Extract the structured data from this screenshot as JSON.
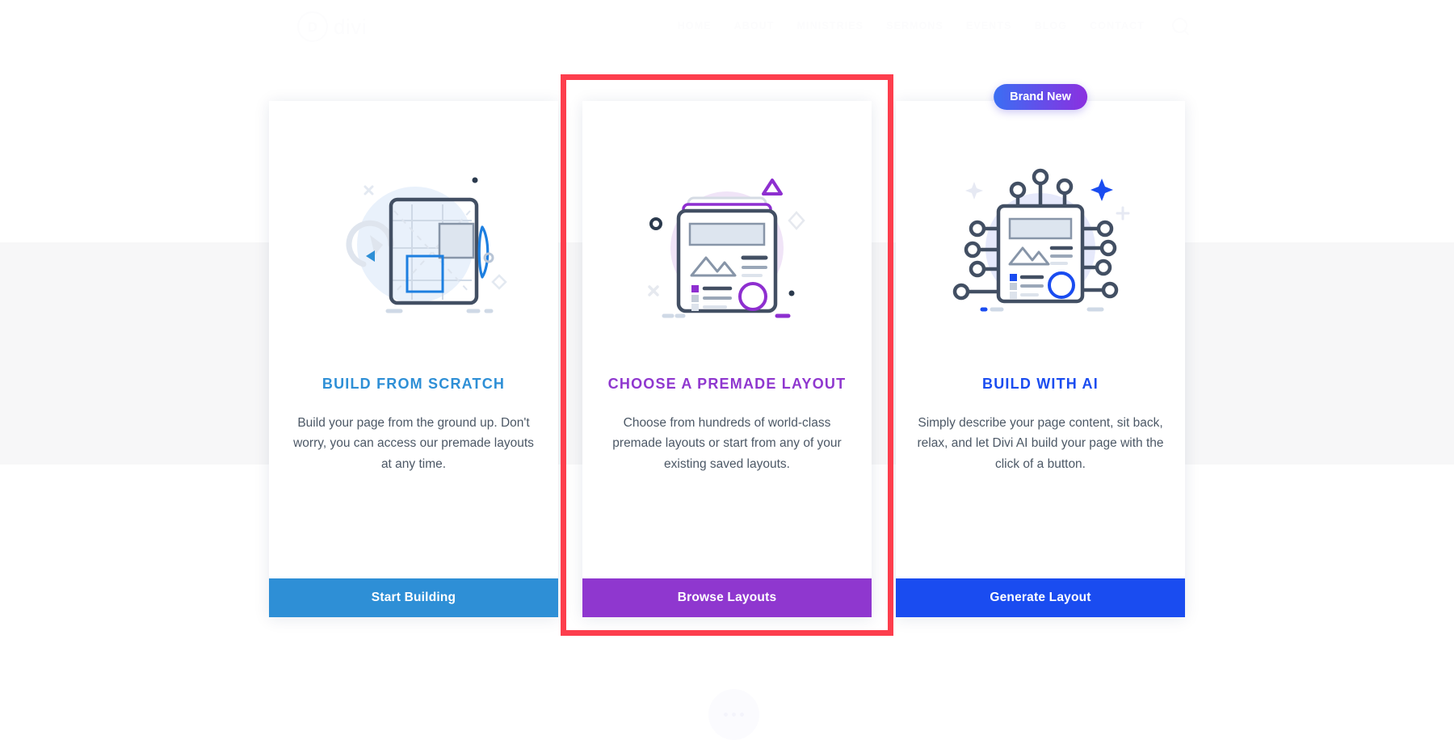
{
  "background_site": {
    "logo": {
      "mark": "D",
      "wordmark": "divi"
    },
    "nav_items": [
      {
        "label": "HOME"
      },
      {
        "label": "ABOUT"
      },
      {
        "label": "MINISTRIES"
      },
      {
        "label": "SERMONS"
      },
      {
        "label": "EVENTS"
      },
      {
        "label": "BLOG"
      },
      {
        "label": "CONTACT"
      }
    ],
    "search_icon": "search-icon",
    "fab_icon": "more-options-icon"
  },
  "colors": {
    "scratch_accent": "#2e8fd6",
    "premade_accent": "#8f37cf",
    "ai_accent": "#1a4cf0",
    "highlight": "#fd3e4d",
    "badge_from": "#3b6ef3",
    "badge_to": "#8b30e0"
  },
  "cards": [
    {
      "id": "build-from-scratch",
      "illustration": "wireframe-grid-illustration",
      "title": "BUILD FROM SCRATCH",
      "description": "Build your page from the ground up. Don't worry, you can access our premade layouts at any time.",
      "button_label": "Start Building",
      "badge": null,
      "selected": false
    },
    {
      "id": "choose-a-premade-layout",
      "illustration": "stacked-layouts-illustration",
      "title": "CHOOSE A PREMADE LAYOUT",
      "description": "Choose from hundreds of world-class premade layouts or start from any of your existing saved layouts.",
      "button_label": "Browse Layouts",
      "badge": null,
      "selected": true
    },
    {
      "id": "build-with-ai",
      "illustration": "ai-circuit-layout-illustration",
      "title": "BUILD WITH AI",
      "description": "Simply describe your page content, sit back, relax, and let Divi AI build your page with the click of a button.",
      "button_label": "Generate Layout",
      "badge": "Brand New",
      "selected": false
    }
  ]
}
